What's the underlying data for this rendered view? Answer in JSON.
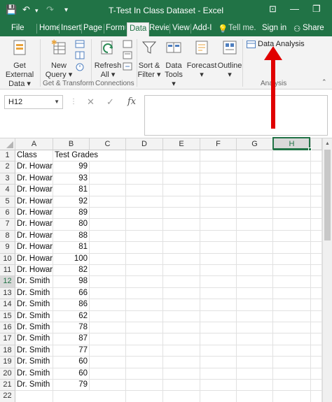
{
  "window": {
    "title": "T-Test In Class Dataset - Excel",
    "quick_access": {
      "save": "💾",
      "undo": "↶",
      "redo": "↷",
      "customize": "▾"
    },
    "controls": {
      "ribbon_options": "⊡",
      "minimize": "—",
      "restore": "❐"
    }
  },
  "tabs": [
    {
      "label": "File"
    },
    {
      "label": "Home"
    },
    {
      "label": "Insert"
    },
    {
      "label": "Page L"
    },
    {
      "label": "Formu"
    },
    {
      "label": "Data"
    },
    {
      "label": "Revie"
    },
    {
      "label": "View"
    },
    {
      "label": "Add-I"
    }
  ],
  "tell_me": "Tell me...",
  "sign_in": "Sign in",
  "share": "Share",
  "ribbon": {
    "get_external_data": [
      "Get External",
      "Data ▾"
    ],
    "new_query": [
      "New",
      "Query ▾"
    ],
    "refresh_all": [
      "Refresh",
      "All ▾"
    ],
    "sort_filter": [
      "Sort &",
      "Filter ▾"
    ],
    "data_tools": [
      "Data",
      "Tools ▾"
    ],
    "forecast": [
      "Forecast",
      "▾"
    ],
    "outline": [
      "Outline",
      "▾"
    ],
    "data_analysis": "Data Analysis",
    "groups": {
      "get_transform": "Get & Transform",
      "connections": "Connections",
      "analysis": "Analysis"
    }
  },
  "name_box": "H12",
  "formula_icons": {
    "cancel": "✕",
    "enter": "✓",
    "fx": "fx"
  },
  "formula_value": "",
  "columns": [
    "A",
    "B",
    "C",
    "D",
    "E",
    "F",
    "G",
    "H"
  ],
  "selected_column": "H",
  "selected_row": 12,
  "rows": [
    {
      "n": "1",
      "a": "Class",
      "b": "Test Grades"
    },
    {
      "n": "2",
      "a": "Dr. Howar",
      "b": "99"
    },
    {
      "n": "3",
      "a": "Dr. Howar",
      "b": "93"
    },
    {
      "n": "4",
      "a": "Dr. Howar",
      "b": "81"
    },
    {
      "n": "5",
      "a": "Dr. Howar",
      "b": "92"
    },
    {
      "n": "6",
      "a": "Dr. Howar",
      "b": "89"
    },
    {
      "n": "7",
      "a": "Dr. Howar",
      "b": "80"
    },
    {
      "n": "8",
      "a": "Dr. Howar",
      "b": "88"
    },
    {
      "n": "9",
      "a": "Dr. Howar",
      "b": "81"
    },
    {
      "n": "10",
      "a": "Dr. Howar",
      "b": "100"
    },
    {
      "n": "11",
      "a": "Dr. Howar",
      "b": "82"
    },
    {
      "n": "12",
      "a": "Dr. Smith",
      "b": "98"
    },
    {
      "n": "13",
      "a": "Dr. Smith",
      "b": "66"
    },
    {
      "n": "14",
      "a": "Dr. Smith",
      "b": "86"
    },
    {
      "n": "15",
      "a": "Dr. Smith",
      "b": "62"
    },
    {
      "n": "16",
      "a": "Dr. Smith",
      "b": "78"
    },
    {
      "n": "17",
      "a": "Dr. Smith",
      "b": "87"
    },
    {
      "n": "18",
      "a": "Dr. Smith",
      "b": "77"
    },
    {
      "n": "19",
      "a": "Dr. Smith",
      "b": "60"
    },
    {
      "n": "20",
      "a": "Dr. Smith",
      "b": "60"
    },
    {
      "n": "21",
      "a": "Dr. Smith",
      "b": "79"
    },
    {
      "n": "22",
      "a": "",
      "b": ""
    }
  ],
  "colors": {
    "excel_green": "#217346",
    "annotation_arrow": "#e00000"
  }
}
